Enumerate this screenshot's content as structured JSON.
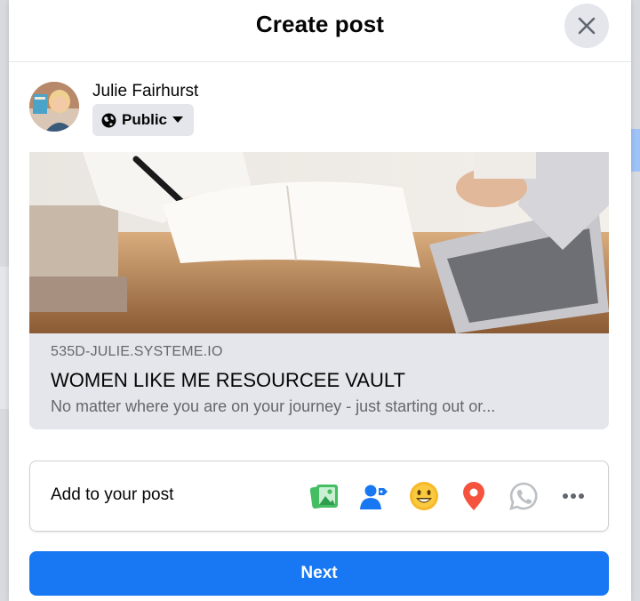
{
  "dialog": {
    "title": "Create post",
    "close_icon": "close-icon"
  },
  "author": {
    "name": "Julie Fairhurst",
    "audience": "Public",
    "audience_icon": "globe-icon"
  },
  "link_preview": {
    "domain": "535D-JULIE.SYSTEME.IO",
    "title": "WOMEN LIKE ME RESOURCEE VAULT",
    "description": "No matter where you are on your journey - just starting out or..."
  },
  "add_to_post": {
    "label": "Add to your post",
    "icons": [
      "photo-video-icon",
      "tag-people-icon",
      "feeling-icon",
      "check-in-icon",
      "whatsapp-icon",
      "more-icon"
    ]
  },
  "footer": {
    "next_label": "Next"
  },
  "colors": {
    "primary": "#1877f2",
    "photo": "#45bd62",
    "tag": "#1877f2",
    "feeling": "#f7b928",
    "checkin": "#f5533d",
    "muted": "#65676b"
  }
}
